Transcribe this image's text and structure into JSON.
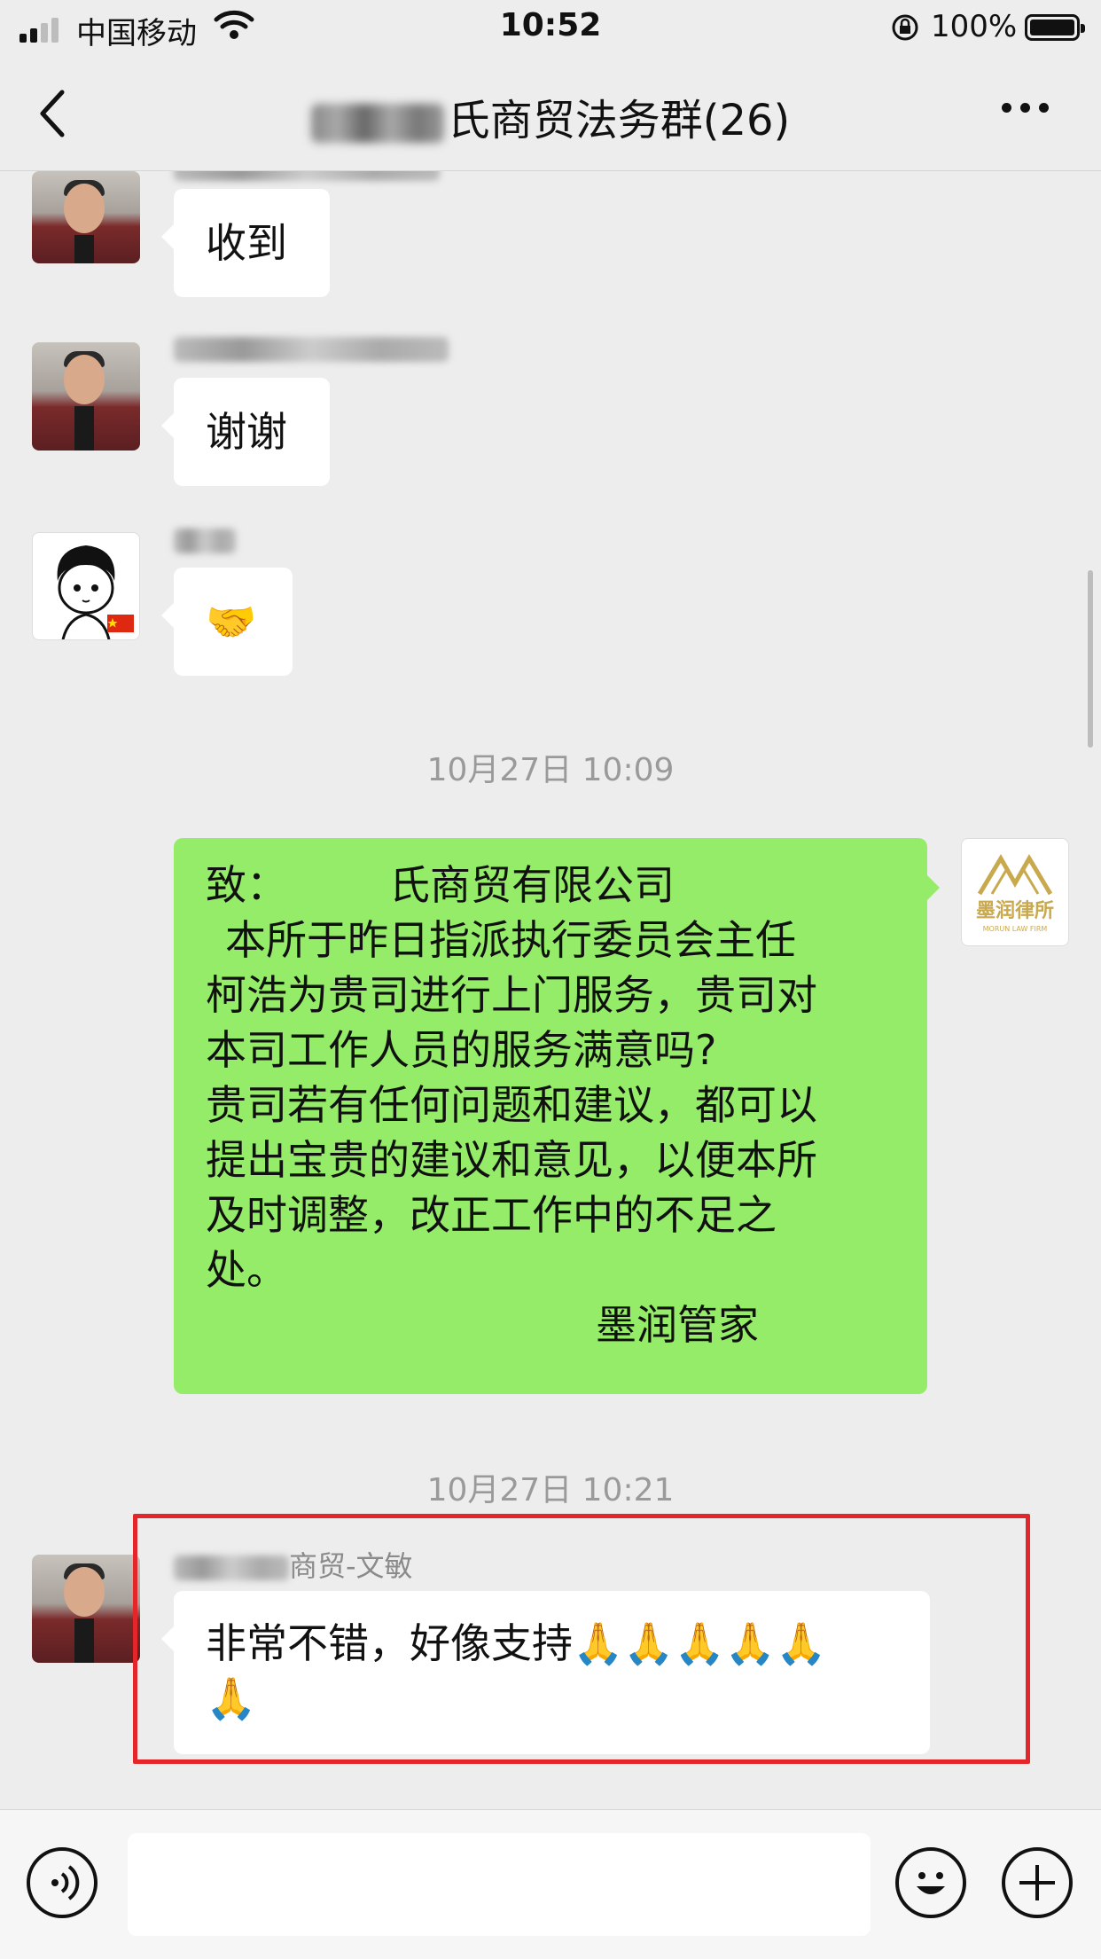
{
  "status_bar": {
    "carrier": "中国移动",
    "time": "10:52",
    "battery": "100%"
  },
  "nav": {
    "title_suffix": "氏商贸法务群(26)"
  },
  "messages": [
    {
      "name_suffix": "",
      "text": "收到"
    },
    {
      "name_suffix": "",
      "text": "谢谢"
    },
    {
      "name_suffix": "",
      "text": "🤝"
    },
    {
      "timestamp": "10月27日 10:09"
    },
    {
      "lines": [
        "致：　　　氏商贸有限公司",
        "本所于昨日指派执行委员会主任",
        "柯浩为贵司进行上门服务，贵司对",
        "本司工作人员的服务满意吗?",
        "贵司若有任何问题和建议，都可以",
        "提出宝贵的建议和意见，以便本所",
        "及时调整，改正工作中的不足之",
        "处。"
      ],
      "signature": "墨润管家"
    },
    {
      "timestamp": "10月27日 10:21"
    },
    {
      "name_suffix": "商贸-文敏",
      "text_line1": "非常不错，好像支持🙏🙏🙏🙏🙏",
      "text_line2": "🙏"
    }
  ],
  "logo_text": "墨润律所",
  "logo_sub": "MORUN LAW FIRM",
  "input": {
    "placeholder": ""
  },
  "colors": {
    "bubble_self": "#95ec69",
    "highlight": "#e4262a"
  },
  "icons": [
    "back-icon",
    "more-icon",
    "voice-icon",
    "emoji-icon",
    "plus-icon"
  ]
}
